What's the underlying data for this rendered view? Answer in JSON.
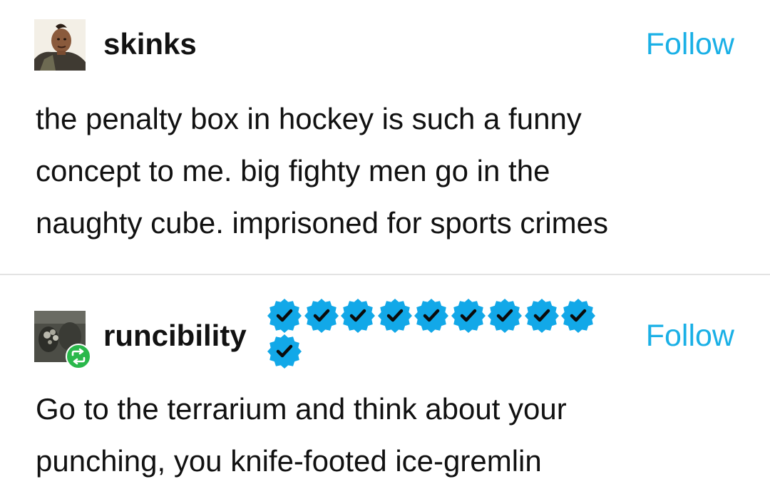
{
  "posts": [
    {
      "username": "skinks",
      "follow_label": "Follow",
      "avatar": "portrait-photo",
      "lines": [
        "the penalty box in hockey is such a funny",
        "concept to me. big fighty men go in the",
        "naughty cube. imprisoned for sports crimes"
      ]
    },
    {
      "username": "runcibility",
      "follow_label": "Follow",
      "avatar": "dark-photo",
      "reblog_icon": "reblog-icon",
      "verified_badge_count": 10,
      "lines": [
        "Go to the terrarium and think about your",
        "punching, you knife-footed ice-gremlin"
      ]
    }
  ],
  "colors": {
    "follow": "#1ab0e6",
    "badge": "#12a8e8",
    "reblog": "#2ab84b",
    "text": "#111111",
    "divider": "#e3e3e3"
  }
}
